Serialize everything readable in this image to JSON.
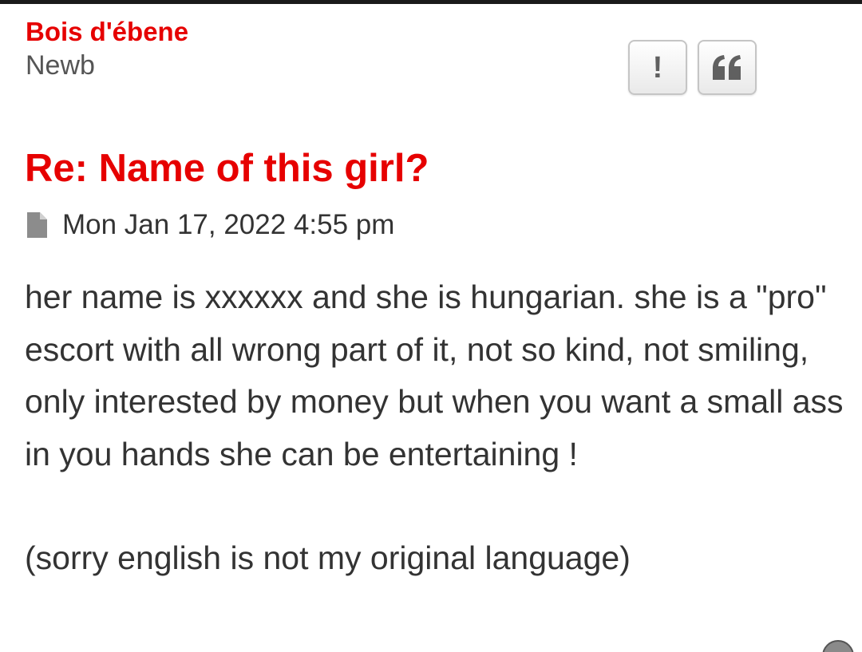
{
  "post": {
    "author": {
      "name": "Bois d'ébene",
      "rank": "Newb"
    },
    "actions": {
      "report_label": "!",
      "quote_label": "❝"
    },
    "title": "Re: Name of this girl?",
    "date": "Mon Jan 17, 2022 4:55 pm",
    "body": {
      "paragraph1": "her name is xxxxxx and she is hungarian. she is a \"pro\" escort with all wrong part of it, not so kind, not smiling, only interested by money but when you want a small ass in you hands she can be entertaining !",
      "paragraph2": "(sorry english is not my original language)"
    }
  },
  "colors": {
    "accent": "#e60000",
    "text": "#333333",
    "muted": "#555555",
    "button_border": "#c5c5c5"
  },
  "icons": {
    "post_date": "document-icon",
    "report": "exclamation-icon",
    "quote": "quote-icon",
    "scroll": "scroll-top-icon"
  }
}
